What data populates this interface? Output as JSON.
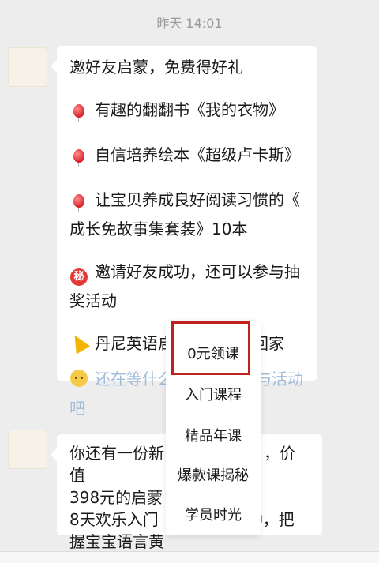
{
  "timestamp": "昨天 14:01",
  "message1": {
    "title": "邀好友启蒙，免费得好礼",
    "items": [
      {
        "icon": "balloon-icon",
        "line1": "有趣的翻翻书《我的衣物》"
      },
      {
        "icon": "balloon-icon",
        "line1": "自信培养绘本《超级卢卡斯》"
      },
      {
        "icon": "balloon-icon",
        "line1": "让宝贝养成良好阅读习惯的《",
        "line2": "成长免故事集套装》10本"
      },
      {
        "icon": "secret-icon",
        "icon_text": "秘",
        "line1": "邀请好友成功，还可以参与抽",
        "line2": "奖活动"
      },
      {
        "icon": "party-popper-icon",
        "line1": "丹尼英语启蒙机等你带回家"
      },
      {
        "icon": "hug-icon",
        "line1_a": "还在等什么",
        "line1_b": "与活动",
        "line2": "吧"
      }
    ]
  },
  "message2": {
    "line1_a": "你还有一份新",
    "line1_b": "，价值",
    "line2": "398元的启蒙",
    "line3_a": "8天欢乐入门",
    "line3_b": "钟，把",
    "line4": "握宝宝语言黄"
  },
  "menu": {
    "items": [
      "0元领课",
      "入门课程",
      "精品年课",
      "爆款课揭秘",
      "学员时光"
    ]
  },
  "colors": {
    "background": "#ededed",
    "bubble": "#ffffff",
    "highlight_border": "#c0211f",
    "timestamp": "#9a9a9a"
  }
}
